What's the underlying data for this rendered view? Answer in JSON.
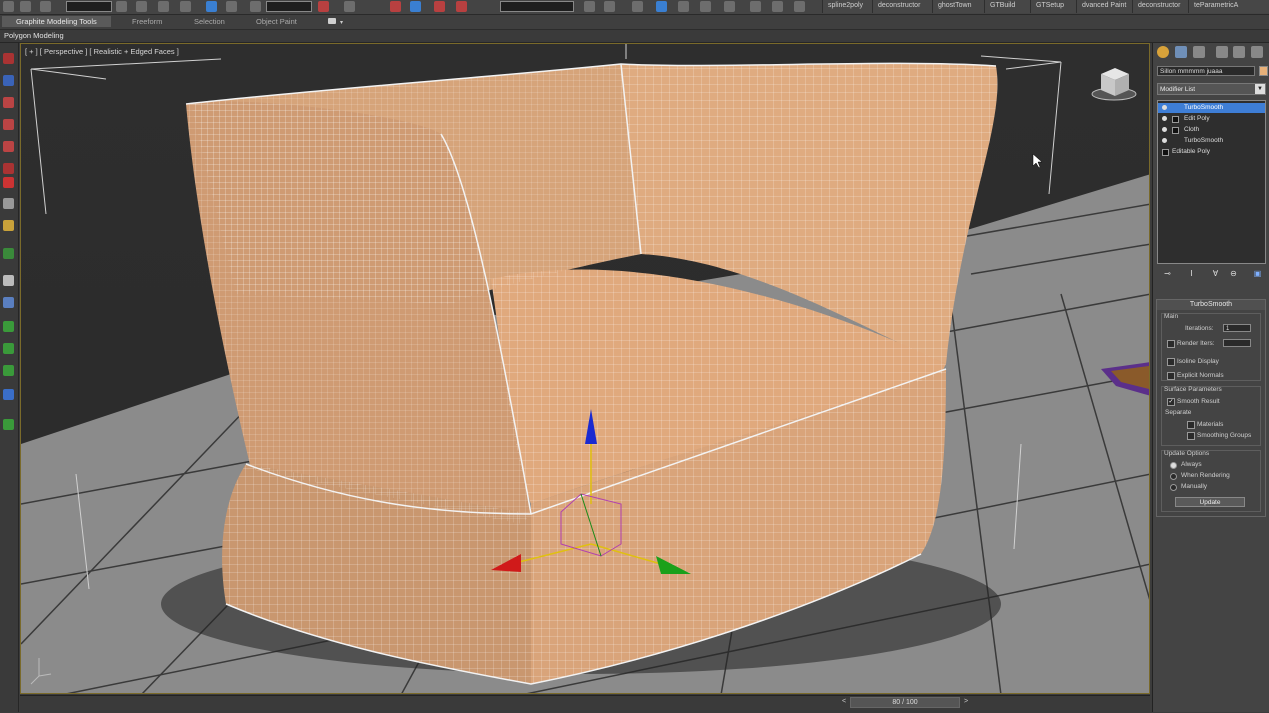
{
  "toolbar": {
    "plugin_tabs": [
      "spline2poly",
      "deconstructor",
      "ghostTown",
      "GTBuild",
      "GTSetup",
      "dvanced Paint",
      "deconstructor",
      "teParametricA"
    ]
  },
  "ribbon": {
    "tabs": [
      "Graphite Modeling Tools",
      "Freeform",
      "Selection",
      "Object Paint"
    ],
    "active_tab": "Graphite Modeling Tools",
    "sub_panel": "Polygon Modeling"
  },
  "viewport": {
    "label": "[ + ] [ Perspective ] [ Realistic + Edged Faces ]",
    "object": "sofa-armchair",
    "mesh_color": "#d9a57a",
    "floor_color": "#8a8a8a"
  },
  "timeline": {
    "frame_display": "80 / 100",
    "current_frame": 80,
    "total_frames": 100
  },
  "command_panel": {
    "object_name": "Sillon mmmmm juaaa",
    "object_color": "#e8b17a",
    "modifier_list_label": "Modifier List",
    "stack": [
      {
        "label": "TurboSmooth",
        "selected": true,
        "has_box": false
      },
      {
        "label": "Edit Poly",
        "selected": false,
        "has_box": true
      },
      {
        "label": "Cloth",
        "selected": false,
        "has_box": true
      },
      {
        "label": "TurboSmooth",
        "selected": false,
        "has_box": false
      },
      {
        "label": "Editable Poly",
        "selected": false,
        "has_box": false
      }
    ],
    "rollout": {
      "title": "TurboSmooth",
      "main_label": "Main",
      "iterations_label": "Iterations:",
      "iterations_value": "1",
      "render_iters_label": "Render Iters:",
      "render_iters_value": "",
      "isoline_display": "Isoline Display",
      "explicit_normals": "Explicit Normals",
      "surface_params_label": "Surface Parameters",
      "smooth_result": "Smooth Result",
      "separate_label": "Separate",
      "materials": "Materials",
      "smoothing_groups": "Smoothing Groups",
      "update_options_label": "Update Options",
      "always": "Always",
      "when_rendering": "When Rendering",
      "manually": "Manually",
      "update_button": "Update"
    },
    "checks": {
      "render_iters": false,
      "isoline_display": false,
      "explicit_normals": false,
      "smooth_result": true,
      "materials": false,
      "smoothing_groups": false
    },
    "update_mode": "Always"
  }
}
